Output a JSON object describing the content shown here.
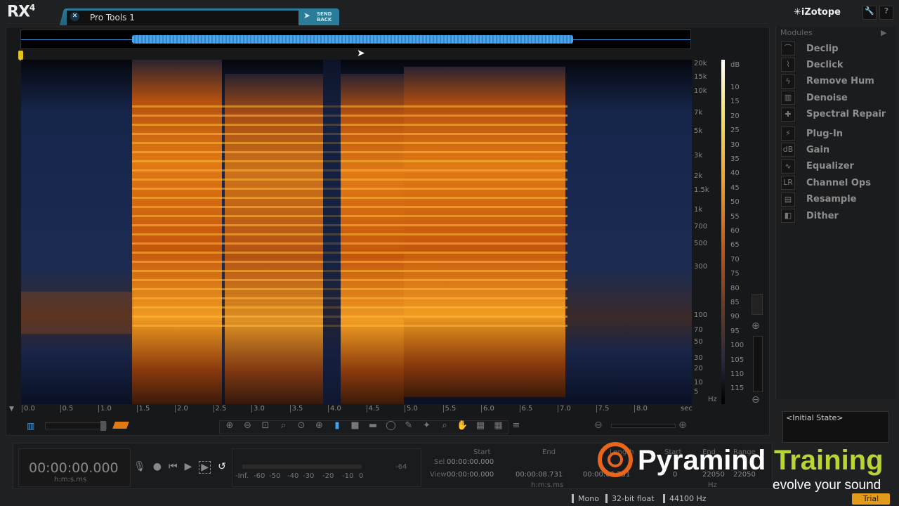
{
  "app": {
    "logo": "RX",
    "logo_version": "4",
    "brand": "iZotope"
  },
  "tab": {
    "label": "Pro Tools 1",
    "send_back": "SEND BACK"
  },
  "freq_axis": {
    "labels": [
      "20k",
      "15k",
      "10k",
      "7k",
      "5k",
      "3k",
      "2k",
      "1.5k",
      "1k",
      "700",
      "500",
      "300",
      "100",
      "70",
      "50",
      "30",
      "20",
      "10",
      "5"
    ],
    "unit": "Hz"
  },
  "db_axis": {
    "unit": "dB",
    "labels": [
      "10",
      "15",
      "20",
      "25",
      "30",
      "35",
      "40",
      "45",
      "50",
      "55",
      "60",
      "65",
      "70",
      "75",
      "80",
      "85",
      "90",
      "95",
      "100",
      "105",
      "110",
      "115"
    ]
  },
  "time_axis": {
    "labels": [
      "0.0",
      "0.5",
      "1.0",
      "1.5",
      "2.0",
      "2.5",
      "3.0",
      "3.5",
      "4.0",
      "4.5",
      "5.0",
      "5.5",
      "6.0",
      "6.5",
      "7.0",
      "7.5",
      "8.0"
    ],
    "unit": "sec"
  },
  "modules": {
    "header": "Modules",
    "items": [
      {
        "label": "Declip",
        "icon": "declip-icon",
        "g": "⌒"
      },
      {
        "label": "Declick",
        "icon": "declick-icon",
        "g": "⌇"
      },
      {
        "label": "Remove Hum",
        "icon": "hum-icon",
        "g": "ϟ"
      },
      {
        "label": "Denoise",
        "icon": "denoise-icon",
        "g": "▥"
      },
      {
        "label": "Spectral Repair",
        "icon": "spectral-repair-icon",
        "g": "✚"
      },
      {
        "label": "Plug-In",
        "icon": "plugin-icon",
        "g": "⚡"
      },
      {
        "label": "Gain",
        "icon": "gain-icon",
        "g": "dB"
      },
      {
        "label": "Equalizer",
        "icon": "eq-icon",
        "g": "∿"
      },
      {
        "label": "Channel Ops",
        "icon": "channel-ops-icon",
        "g": "LR"
      },
      {
        "label": "Resample",
        "icon": "resample-icon",
        "g": "▤"
      },
      {
        "label": "Dither",
        "icon": "dither-icon",
        "g": "◧"
      }
    ]
  },
  "history": {
    "state": "<Initial State>"
  },
  "transport": {
    "time": "00:00:00.000",
    "format": "h:m:s.ms"
  },
  "meter": {
    "peak": "-64",
    "labels": [
      "-Inf.",
      "-60",
      "-50",
      "-40",
      "-30",
      "-20",
      "-10",
      "0"
    ]
  },
  "selection": {
    "headers": [
      "Start",
      "End",
      "Length"
    ],
    "sel_label": "Sel",
    "view_label": "View",
    "sel": [
      "00:00:00.000",
      "",
      ""
    ],
    "view": [
      "00:00:00.000",
      "00:00:08.731",
      "00:00:08.731"
    ],
    "format": "h:m:s.ms",
    "freq_headers": [
      "Start",
      "End",
      "Range"
    ],
    "freq_view": [
      "0",
      "22050",
      "22050"
    ],
    "freq_unit": "Hz"
  },
  "status": {
    "channels": "Mono",
    "bit_depth": "32-bit float",
    "sample_rate": "44100 Hz",
    "trial": "Trial"
  },
  "watermark": {
    "name": "Pyramind",
    "name2": "Training",
    "tagline": "evolve your sound"
  }
}
